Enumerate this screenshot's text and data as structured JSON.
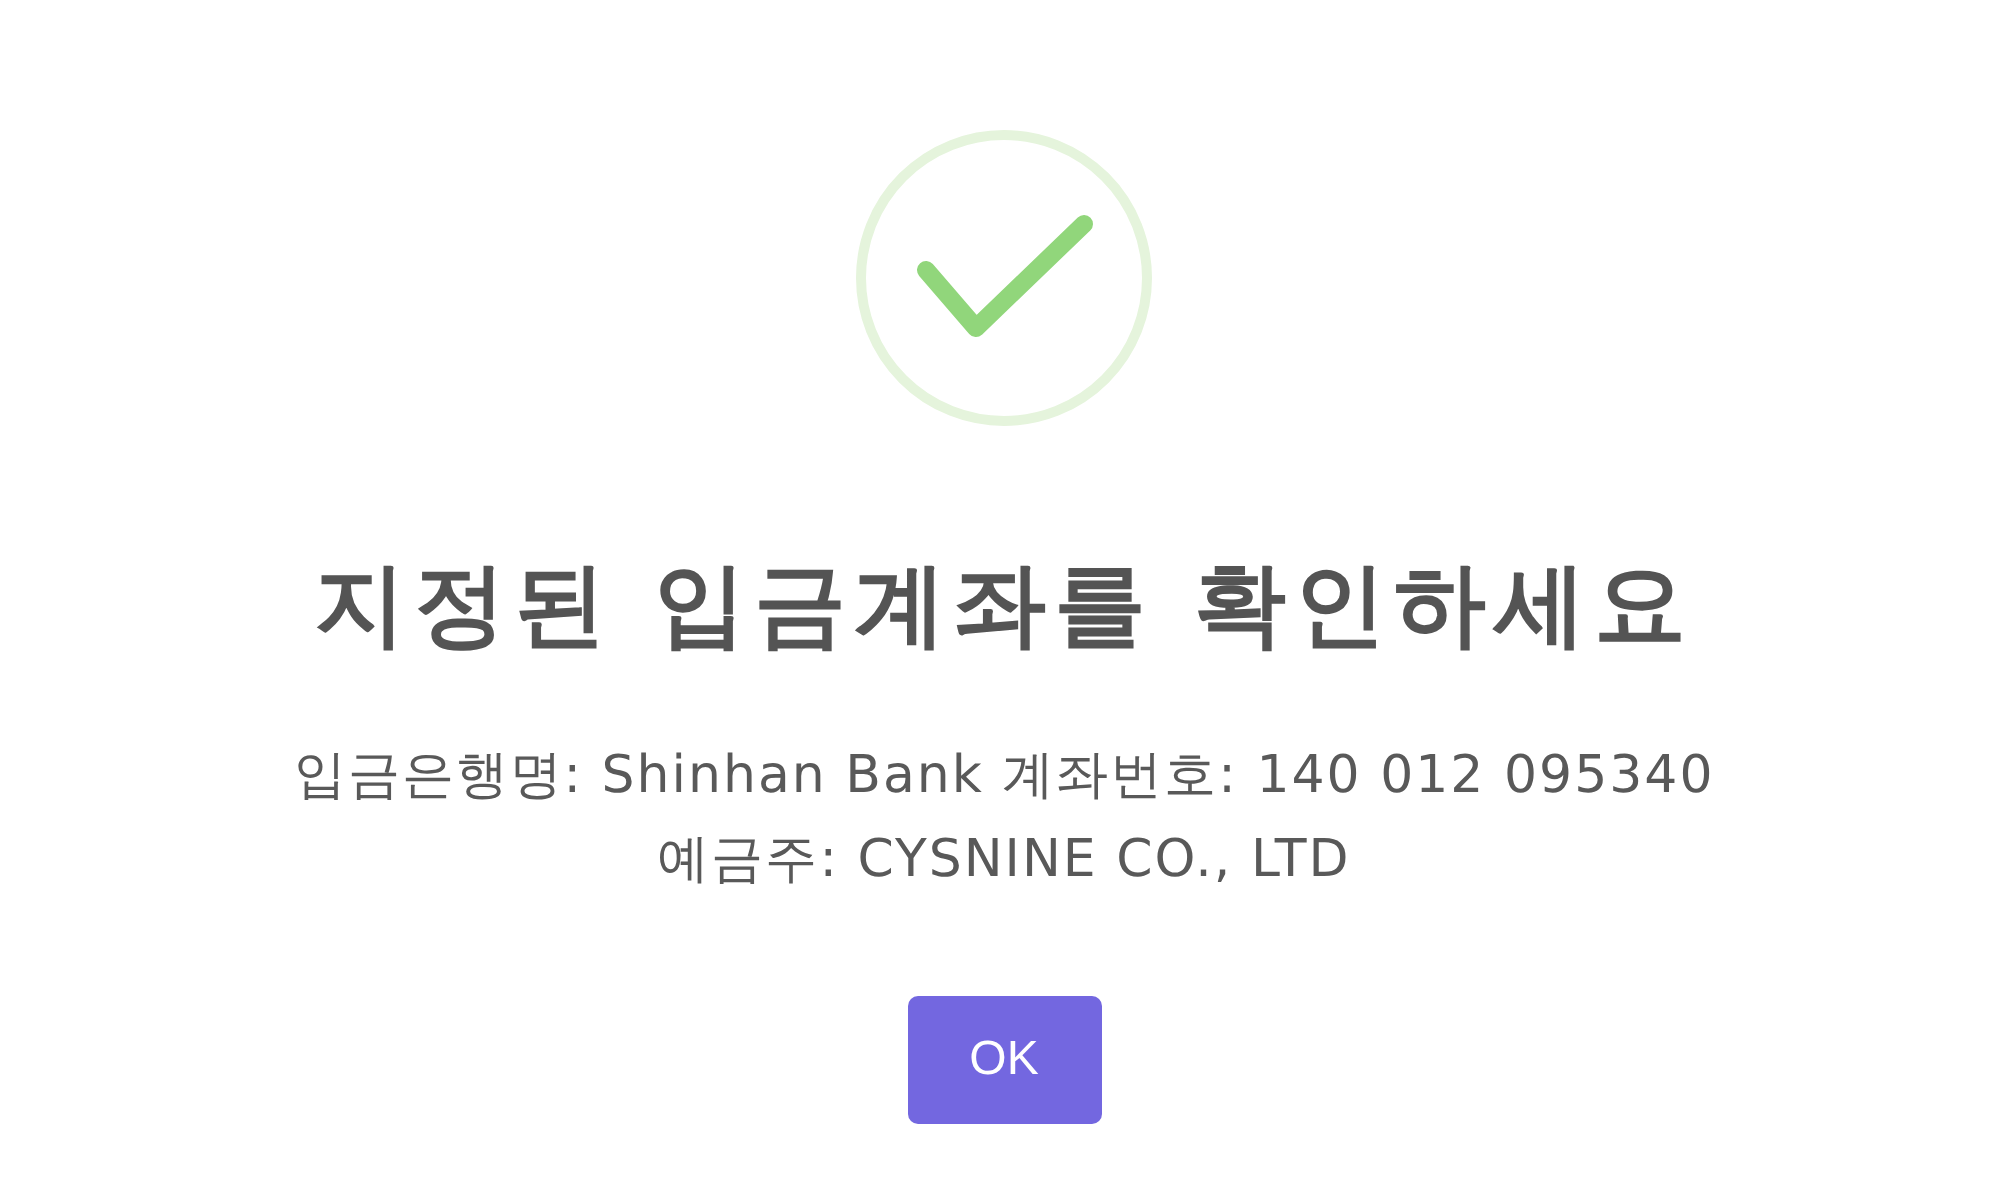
{
  "icon": {
    "kind": "success"
  },
  "title": "지정된 입금계좌를 확인하세요",
  "message": {
    "lines": [
      "입금은행명: Shinhan Bank 계좌번호: 140 012 095340",
      "예금주: CYSNINE CO., LTD"
    ]
  },
  "confirm_button": {
    "label": "OK"
  }
}
